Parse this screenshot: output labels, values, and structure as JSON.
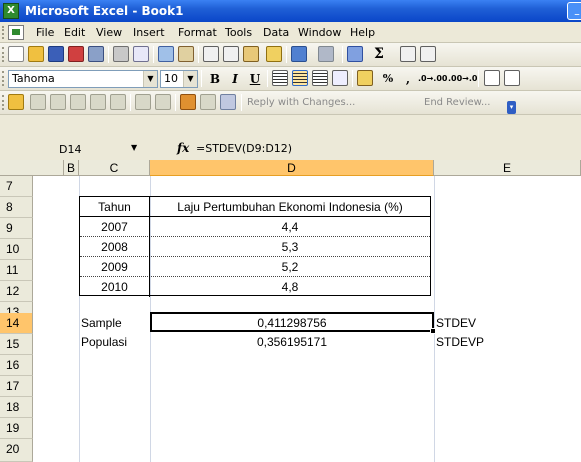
{
  "window": {
    "title": "Microsoft Excel - Book1",
    "app_icon_label": "X"
  },
  "menu": [
    "File",
    "Edit",
    "View",
    "Insert",
    "Format",
    "Tools",
    "Data",
    "Window",
    "Help"
  ],
  "toolbar": {
    "font_name": "Tahoma",
    "font_size": "10",
    "bold": "B",
    "italic": "I",
    "underline": "U",
    "percent": "%",
    "comma": ",",
    "increase_decimal": ".0→.00",
    "decrease_decimal": ".00→.0",
    "sum": "Σ",
    "reply_with_changes": "Reply with Changes...",
    "end_review": "End Review..."
  },
  "formula_bar": {
    "name_box": "D14",
    "fx": "fx",
    "formula": "=STDEV(D9:D12)"
  },
  "columns": [
    "B",
    "C",
    "D",
    "E"
  ],
  "rows": [
    "7",
    "8",
    "9",
    "10",
    "11",
    "12",
    "13",
    "14",
    "15",
    "16",
    "17",
    "18",
    "19",
    "20"
  ],
  "table": {
    "headers": [
      "Tahun",
      "Laju Pertumbuhan Ekonomi Indonesia (%)"
    ],
    "rows": [
      [
        "2007",
        "4,4"
      ],
      [
        "2008",
        "5,3"
      ],
      [
        "2009",
        "5,2"
      ],
      [
        "2010",
        "4,8"
      ]
    ]
  },
  "results": [
    {
      "label": "Sample",
      "value": "0,411298756",
      "function": "STDEV"
    },
    {
      "label": "Populasi",
      "value": "0,356195171",
      "function": "STDEVP"
    }
  ],
  "colors": {
    "title_bar": "#0a46c8",
    "selected_header": "#ffc56b",
    "chrome": "#ece9d8"
  }
}
